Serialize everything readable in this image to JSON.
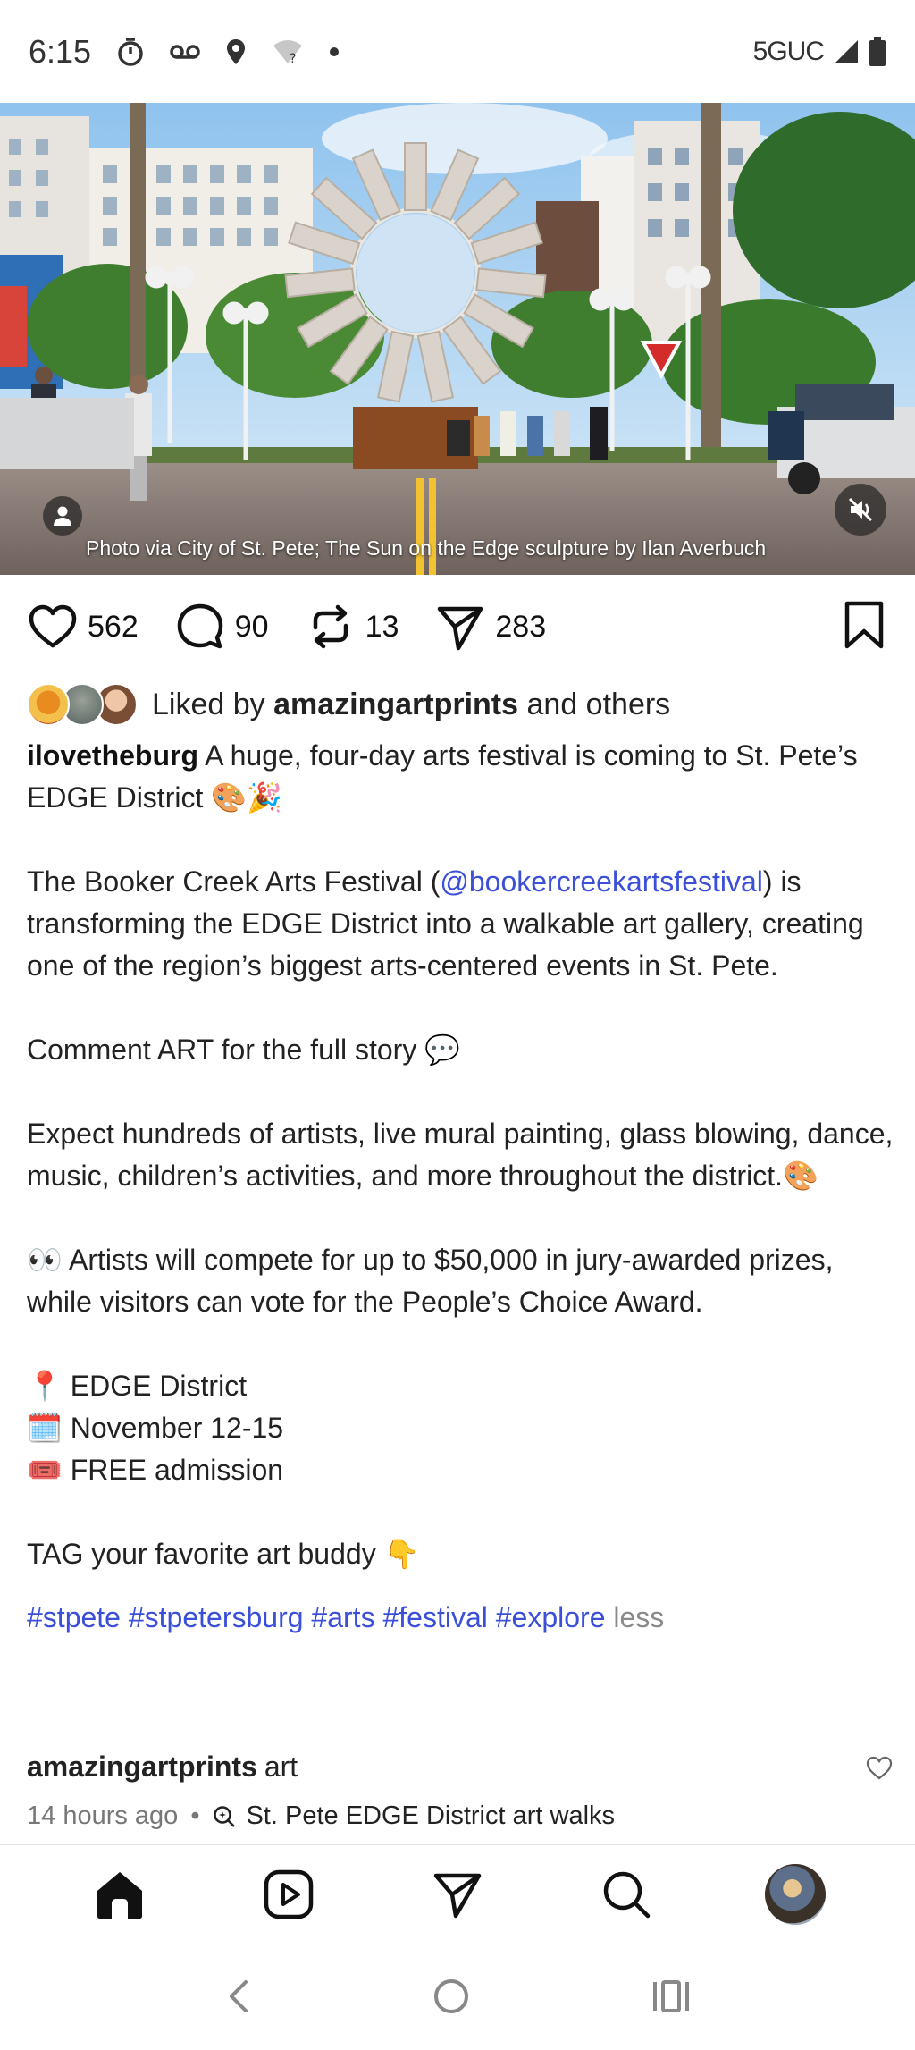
{
  "status_bar": {
    "time": "6:15",
    "network": "5GUC",
    "icons": [
      "timer-icon",
      "voicemail-icon",
      "location-icon",
      "wifi-question-icon",
      "dot-icon",
      "signal-icon",
      "battery-icon"
    ]
  },
  "post": {
    "image_caption": "Photo via City of St. Pete; The Sun on the Edge sculpture by Ilan Averbuch",
    "likes_count": "562",
    "comments_count": "90",
    "reposts_count": "13",
    "shares_count": "283",
    "liked_by_prefix": "Liked by",
    "liked_by_user": "amazingartprints",
    "liked_by_suffix": "and others",
    "username": "ilovetheburg",
    "caption_intro": "A huge, four-day arts festival is coming to St. Pete’s EDGE District",
    "caption_intro_emoji": "🎨🎉",
    "p1_before": "The Booker Creek Arts Festival (",
    "p1_mention": "@bookercreekartsfestival",
    "p1_after": ") is transforming the EDGE District into a walkable art gallery, creating one of the region’s biggest arts-centered events in St. Pete.",
    "p2_text": "Comment ART for the full story",
    "p2_emoji": "💬",
    "p3_text": "Expect hundreds of artists, live mural painting, glass blowing, dance, music, children’s activities, and more throughout the district.",
    "p3_emoji": "🎨",
    "p4_emoji": "👀",
    "p4_text": "Artists will compete for up to $50,000 in jury-awarded prizes, while visitors can vote for the People’s Choice Award.",
    "location_emoji": "📍",
    "location": "EDGE District",
    "date_emoji": "🗓️",
    "date": "November 12-15",
    "ticket_emoji": "🎟️",
    "admission": "FREE admission",
    "tag_text": "TAG your favorite art buddy",
    "tag_emoji": "👇",
    "hashtags": "#stpete #stpetersburg #arts #festival #explore",
    "less_label": "less"
  },
  "comment": {
    "user": "amazingartprints",
    "text": "art"
  },
  "meta": {
    "time_ago": "14 hours ago",
    "dot": "•",
    "topic": "St. Pete EDGE District art walks"
  },
  "colors": {
    "link_blue": "#3b4fd8",
    "text": "#222222",
    "muted": "#777777"
  }
}
